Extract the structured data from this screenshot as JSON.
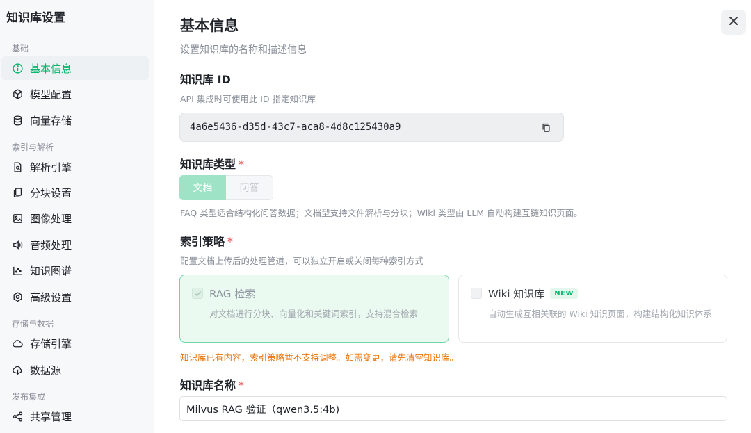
{
  "sidebar": {
    "title": "知识库设置",
    "groups": [
      {
        "label": "基础",
        "items": [
          {
            "label": "基本信息",
            "icon": "info-icon",
            "active": true
          },
          {
            "label": "模型配置",
            "icon": "cube-icon"
          },
          {
            "label": "向量存储",
            "icon": "database-icon"
          }
        ]
      },
      {
        "label": "索引与解析",
        "items": [
          {
            "label": "解析引擎",
            "icon": "file-search-icon"
          },
          {
            "label": "分块设置",
            "icon": "copy-pages-icon"
          },
          {
            "label": "图像处理",
            "icon": "image-icon"
          },
          {
            "label": "音频处理",
            "icon": "audio-icon"
          },
          {
            "label": "知识图谱",
            "icon": "graph-icon"
          },
          {
            "label": "高级设置",
            "icon": "settings-icon"
          }
        ]
      },
      {
        "label": "存储与数据",
        "items": [
          {
            "label": "存储引擎",
            "icon": "cloud-icon"
          },
          {
            "label": "数据源",
            "icon": "cloud-download-icon"
          }
        ]
      },
      {
        "label": "发布集成",
        "items": [
          {
            "label": "共享管理",
            "icon": "share-icon"
          }
        ]
      }
    ]
  },
  "main": {
    "title": "基本信息",
    "subtitle": "设置知识库的名称和描述信息",
    "kb_id": {
      "label": "知识库 ID",
      "description": "API 集成时可使用此 ID 指定知识库",
      "value": "4a6e5436-d35d-43c7-aca8-4d8c125430a9"
    },
    "kb_type": {
      "label": "知识库类型",
      "required_mark": "*",
      "options": [
        "文档",
        "问答"
      ],
      "selected": "文档",
      "description": "FAQ 类型适合结构化问答数据；文档型支持文件解析与分块；Wiki 类型由 LLM 自动构建互链知识页面。"
    },
    "index_strategy": {
      "label": "索引策略",
      "required_mark": "*",
      "description": "配置文档上传后的处理管道，可以独立开启或关闭每种索引方式",
      "options": [
        {
          "title": "RAG 检索",
          "description": "对文档进行分块、向量化和关键词索引，支持混合检索",
          "checked": true
        },
        {
          "title": "Wiki 知识库",
          "badge": "NEW",
          "description": "自动生成互相关联的 Wiki 知识页面，构建结构化知识体系",
          "checked": false
        }
      ],
      "warning": "知识库已有内容，索引策略暂不支持调整。如需变更，请先清空知识库。"
    },
    "kb_name": {
      "label": "知识库名称",
      "required_mark": "*",
      "value": "Milvus RAG 验证（qwen3.5:4b)"
    }
  },
  "colors": {
    "accent": "#07b66d",
    "warning": "#e8740c",
    "required": "#e54545"
  }
}
